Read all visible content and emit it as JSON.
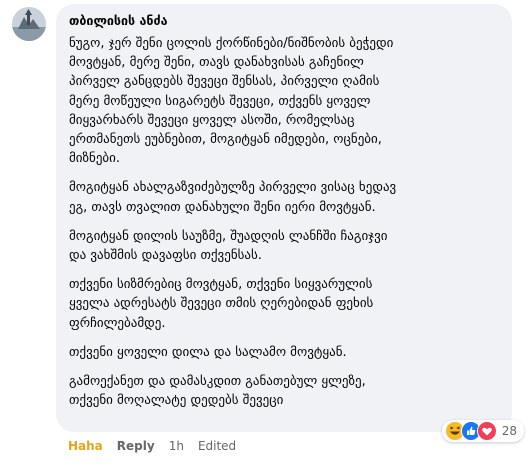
{
  "comment": {
    "author": "თბილისის ანძა",
    "paragraphs": [
      "ნუგო, ჯერ შენი ცოლის ქორწინები/ნიშნობის ბეჭედი\nმოვტყან, მერე შენი, თავს დანახვისას გაჩენილ\nპირველ განცდებს შევეცი შენსას, პირველი ღამის\nმერე მოწეული სიგარეტს შევეცი, თქვენს ყოველ\nმიყვარხარს შევეცი ყოველ ასოში, რომელსაც\nერთმანეთს ეუბნებით, მოგიტყან იმედები, ოცნები,\nმიზნები.",
      "მოგიტყან ახალგაზვიძებულზე პირველი ვისაც ხედავ\nეგ, თავს თვალით დანახული შენი იერი მოვტყან.",
      "მოგიტყან დილის საუზმე, შუადღის ლანჩში ჩაგიჯვი\nდა ვახშმის დავაფსი თქვენსას.",
      "თქვენი სიზმრებიც მოვტყან, თქვენი სიყვარულის\nყველა ადრესატს შევეცი თმის ღერებიდან ფეხის\nფრჩილებამდე.",
      "თქვენი ყოველი დილა და სალამო მოვტყან.",
      "გამოექანეთ და დამასკდით განათებულ ყლეზე,\nთქვენი მოღალატე დედებს შევეცი"
    ],
    "reactions": {
      "icons": [
        "haha-reaction-icon",
        "like-reaction-icon",
        "love-reaction-icon"
      ],
      "count": "28"
    }
  },
  "actions": {
    "haha_label": "Haha",
    "reply_label": "Reply",
    "time": "1h",
    "edited_label": "Edited"
  },
  "colors": {
    "bubble_bg": "#f0f2f5",
    "haha": "#e5a51b",
    "meta": "#65676b",
    "like": "#1877f2",
    "love": "#f33e58"
  }
}
